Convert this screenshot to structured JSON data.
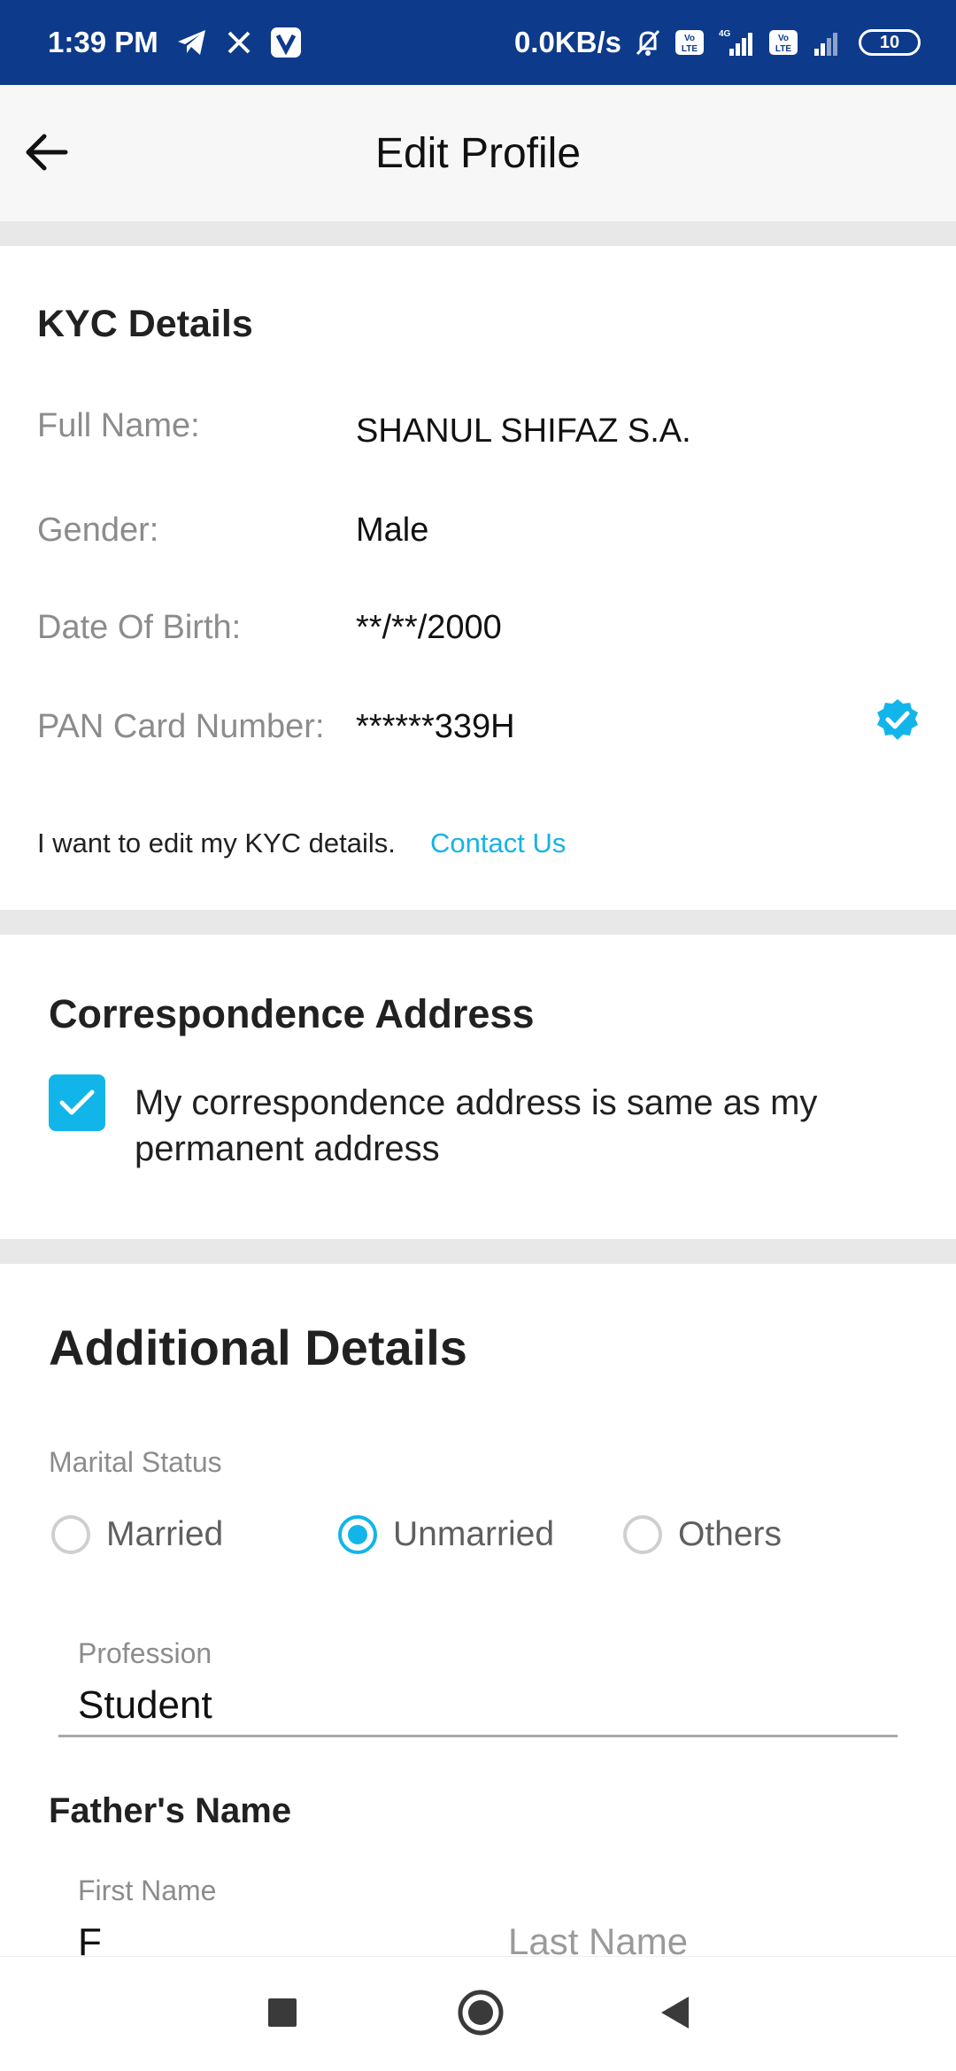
{
  "status_bar": {
    "time": "1:39 PM",
    "network_speed": "0.0KB/s",
    "battery": "10",
    "icons": [
      "telegram-icon",
      "x-icon",
      "app-v-icon",
      "mute-bell-icon",
      "volte-icon",
      "signal-4g-icon",
      "volte-icon",
      "signal-icon",
      "battery-icon"
    ]
  },
  "app_bar": {
    "title": "Edit Profile",
    "back_icon": "arrow-left-icon"
  },
  "kyc": {
    "title": "KYC Details",
    "full_name_label": "Full Name:",
    "full_name": "SHANUL SHIFAZ S.A.",
    "gender_label": "Gender:",
    "gender": "Male",
    "dob_label": "Date Of Birth:",
    "dob": "**/**/2000",
    "pan_label": "PAN Card Number:",
    "pan": "******339H",
    "verified_icon": "verified-badge-icon",
    "edit_note": "I want to edit my KYC details.",
    "contact_link": "Contact Us"
  },
  "correspondence": {
    "title": "Correspondence Address",
    "checkbox_checked": true,
    "checkbox_label": "My correspondence address is same as my permanent address"
  },
  "additional": {
    "title": "Additional Details",
    "marital_label": "Marital Status",
    "marital_options": [
      "Married",
      "Unmarried",
      "Others"
    ],
    "marital_selected": "Unmarried",
    "profession_label": "Profession",
    "profession_value": "Student",
    "fathers_name_title": "Father's Name",
    "first_name_label": "First Name",
    "first_name_value": "F",
    "last_name_placeholder": "Last Name"
  },
  "nav_bar": {
    "icons": [
      "recents-square-icon",
      "home-circle-icon",
      "back-triangle-icon"
    ]
  },
  "colors": {
    "status_bar_bg": "#0d3a8a",
    "accent": "#12b5ea",
    "link": "#16b3e6",
    "divider": "#e8e8e8"
  }
}
